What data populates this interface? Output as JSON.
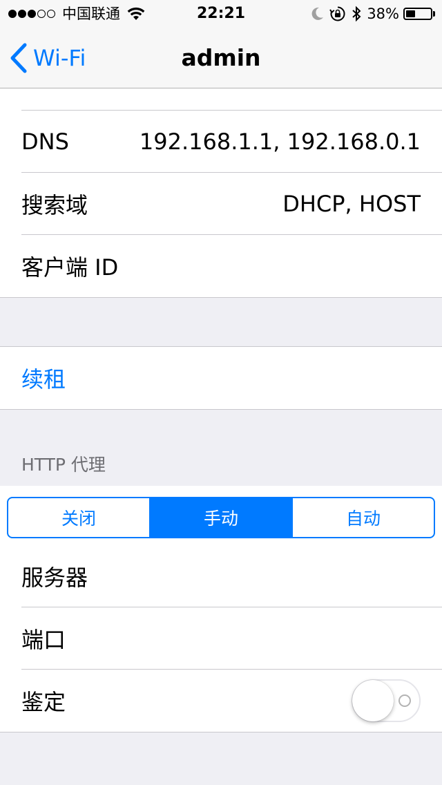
{
  "status_bar": {
    "carrier": "中国联通",
    "signal_bars_filled": 3,
    "signal_bars_total": 5,
    "time": "22:21",
    "battery_percent": "38%",
    "battery_level": 0.38,
    "icons": [
      "wifi-icon",
      "moon-icon",
      "orientation-lock-icon",
      "bluetooth-icon",
      "battery-icon"
    ]
  },
  "nav": {
    "back_label": "Wi-Fi",
    "title": "admin"
  },
  "dhcp_rows": [
    {
      "label": "DNS",
      "value": "192.168.1.1, 192.168.0.1"
    },
    {
      "label": "搜索域",
      "value": "DHCP, HOST"
    },
    {
      "label": "客户端 ID",
      "value": ""
    }
  ],
  "renew": {
    "label": "续租"
  },
  "http_proxy": {
    "header": "HTTP 代理",
    "segments": [
      "关闭",
      "手动",
      "自动"
    ],
    "selected_segment": "手动",
    "rows": [
      {
        "label": "服务器"
      },
      {
        "label": "端口"
      },
      {
        "label": "鉴定",
        "toggle_on": false
      }
    ]
  },
  "colors": {
    "accent": "#007aff",
    "background": "#efeff4",
    "separator": "#c8c7cc",
    "section_header": "#6d6d72"
  }
}
